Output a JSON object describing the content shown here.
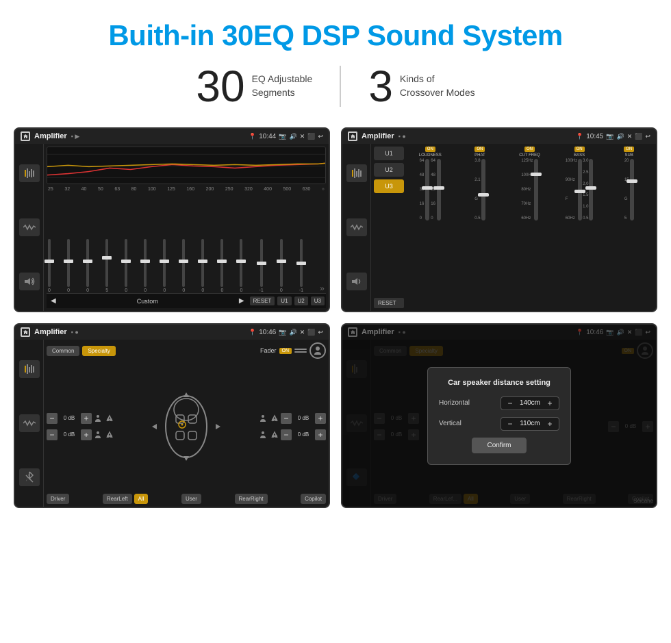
{
  "header": {
    "title": "Buith-in 30EQ DSP Sound System"
  },
  "stats": {
    "eq": {
      "number": "30",
      "label_line1": "EQ Adjustable",
      "label_line2": "Segments"
    },
    "crossover": {
      "number": "3",
      "label_line1": "Kinds of",
      "label_line2": "Crossover Modes"
    }
  },
  "screen1": {
    "title": "Amplifier",
    "time": "10:44",
    "eq_labels": [
      "25",
      "32",
      "40",
      "50",
      "63",
      "80",
      "100",
      "125",
      "160",
      "200",
      "250",
      "320",
      "400",
      "500",
      "630"
    ],
    "bottom": {
      "preset": "Custom",
      "reset": "RESET",
      "u1": "U1",
      "u2": "U2",
      "u3": "U3"
    }
  },
  "screen2": {
    "title": "Amplifier",
    "time": "10:45",
    "channels": [
      "LOUDNESS",
      "PHAT",
      "CUT FREQ",
      "BASS",
      "SUB"
    ],
    "presets": [
      "U1",
      "U2",
      "U3"
    ],
    "reset": "RESET"
  },
  "screen3": {
    "title": "Amplifier",
    "time": "10:46",
    "buttons": {
      "common": "Common",
      "specialty": "Specialty",
      "fader": "Fader",
      "fader_on": "ON",
      "driver": "Driver",
      "rear_left": "RearLeft",
      "all": "All",
      "user": "User",
      "rear_right": "RearRight",
      "copilot": "Copilot"
    },
    "db_values": [
      "0 dB",
      "0 dB",
      "0 dB",
      "0 dB"
    ]
  },
  "screen4": {
    "title": "Amplifier",
    "time": "10:46",
    "dialog": {
      "title": "Car speaker distance setting",
      "horizontal_label": "Horizontal",
      "horizontal_value": "140cm",
      "vertical_label": "Vertical",
      "vertical_value": "110cm",
      "confirm_btn": "Confirm"
    },
    "buttons": {
      "common": "Common",
      "specialty": "Specialty",
      "driver": "Driver",
      "rear_left": "RearLef...",
      "all": "All",
      "user": "User",
      "rear_right": "RearRight",
      "copilot": "Copilot"
    },
    "db_values": [
      "0 dB",
      "0 dB"
    ]
  },
  "watermark": "Seicane"
}
